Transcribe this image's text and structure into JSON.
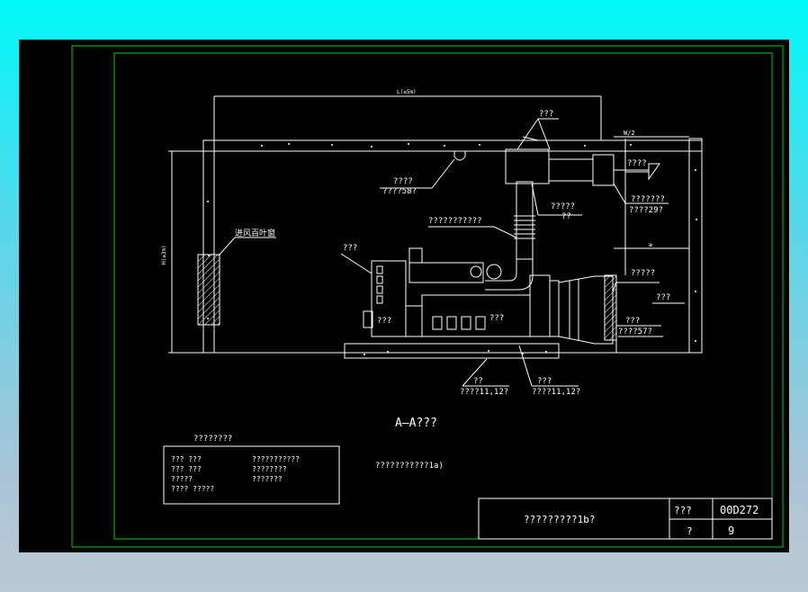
{
  "colors": {
    "background_top": "#00f8f8",
    "sheet": "#000000",
    "border": "#00d000",
    "lines": "#ffffff",
    "hatch": "#ffffff"
  },
  "drawing": {
    "dim_top": "L(≥5m)",
    "dim_left": "H(≥3m)",
    "dim_w2": "W/2",
    "dim_right": "≥",
    "louver_label": "进风百叶窗",
    "callouts": {
      "a": "???",
      "b1": "????",
      "b2": "????58?",
      "c1": "?????",
      "c2": "??",
      "d": "???????????",
      "e1": "????",
      "e2": "???????",
      "e3": "????29?",
      "f": "???",
      "g": "?????",
      "h": "???",
      "i": "???",
      "j": "???",
      "k1": "???",
      "k2": "????57?",
      "l1": "??",
      "l2": "????11,12?",
      "m1": "???",
      "m2": "????11,12?"
    },
    "section_title": "A—A???",
    "note": "???????????1a)"
  },
  "legend": {
    "title": "????????",
    "rows": [
      [
        "???   ???",
        "???????????"
      ],
      [
        "???   ???",
        "????????"
      ],
      [
        "?????",
        "???????"
      ],
      [
        "????  ?????",
        ""
      ]
    ]
  },
  "title_block": {
    "drawing_name": "?????????1b?",
    "label_top": "???",
    "code": "00D272",
    "label_bottom": "?",
    "page": "9"
  }
}
